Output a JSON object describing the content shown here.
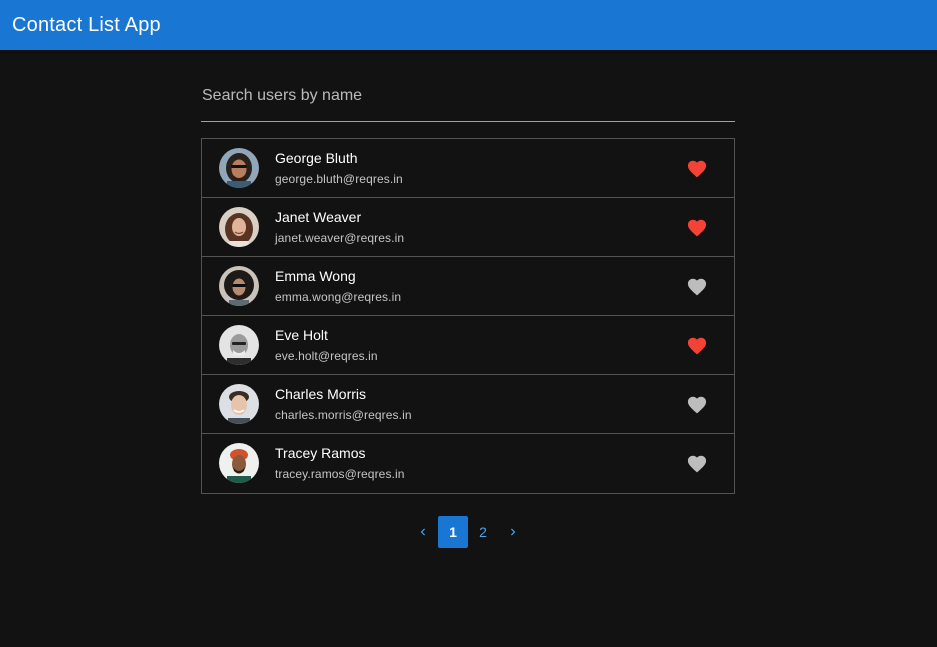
{
  "app": {
    "title": "Contact List App",
    "accent": "#1976d2"
  },
  "search": {
    "placeholder": "Search users by name",
    "value": ""
  },
  "contacts": [
    {
      "name": "George Bluth",
      "email": "george.bluth@reqres.in",
      "favorite": true
    },
    {
      "name": "Janet Weaver",
      "email": "janet.weaver@reqres.in",
      "favorite": true
    },
    {
      "name": "Emma Wong",
      "email": "emma.wong@reqres.in",
      "favorite": false
    },
    {
      "name": "Eve Holt",
      "email": "eve.holt@reqres.in",
      "favorite": true
    },
    {
      "name": "Charles Morris",
      "email": "charles.morris@reqres.in",
      "favorite": false
    },
    {
      "name": "Tracey Ramos",
      "email": "tracey.ramos@reqres.in",
      "favorite": false
    }
  ],
  "favorite_icon": "heart-icon",
  "favorite_colors": {
    "on": "#f44336",
    "off": "#bdbdbd"
  },
  "pagination": {
    "prev_icon": "chevron-left-icon",
    "next_icon": "chevron-right-icon",
    "pages": [
      "1",
      "2"
    ],
    "current": "1"
  }
}
